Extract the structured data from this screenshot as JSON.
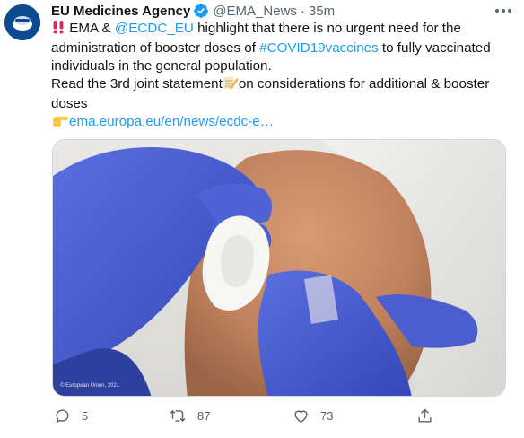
{
  "account": {
    "name": "EU Medicines Agency",
    "handle": "@EMA_News",
    "separator": "·",
    "time": "35m",
    "avatar_icon": "ema-logo-icon",
    "verified_icon": "verified-badge-icon"
  },
  "tweet": {
    "line1_emoji": "‼️",
    "line1_part1": " EMA & ",
    "mention": "@ECDC_EU",
    "line1_part2": " highlight that there is no urgent need for the administration of booster doses of ",
    "hashtag": "#COVID19vaccines",
    "line1_part3": " to fully vaccinated individuals in the general population.",
    "line2_part1": "Read the 3rd joint statement",
    "line2_emoji": "📝",
    "line2_part2": "on considerations for additional & booster doses",
    "link_emoji": "👉",
    "link_text": "ema.europa.eu/en/news/ecdc-e…"
  },
  "media": {
    "description": "photo-vaccination-swab",
    "copyright": "© European Union, 2021"
  },
  "actions": {
    "reply_count": "5",
    "retweet_count": "87",
    "like_count": "73"
  },
  "colors": {
    "link": "#1d9bf0",
    "secondary_text": "#536471",
    "verified": "#1d9bf0"
  }
}
